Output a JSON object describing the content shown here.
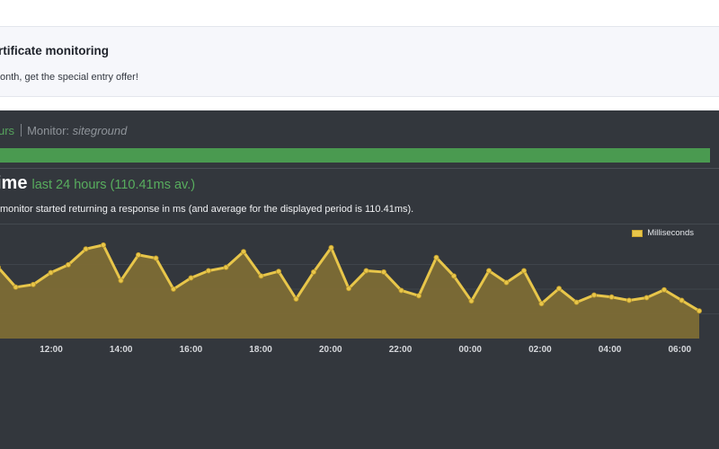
{
  "promo": {
    "title": "rtificate monitoring",
    "text": "onth, get the special entry offer!"
  },
  "monitor": {
    "period_fragment": "urs",
    "label": "Monitor:",
    "name": "siteground"
  },
  "response_time": {
    "title_fragment": "ime",
    "subtitle": "last 24 hours (110.41ms av.)",
    "description": "monitor started returning a response in ms (and average for the displayed period is 110.41ms)."
  },
  "colors": {
    "panel": "#33373d",
    "status_up": "#4a9a50",
    "series_line": "#e8c64a",
    "series_fill": "#7d6c35"
  },
  "chart_data": {
    "type": "area",
    "legend": [
      "Milliseconds"
    ],
    "legend_position": "top-right",
    "x_tick_labels": [
      "12:00",
      "14:00",
      "16:00",
      "18:00",
      "20:00",
      "22:00",
      "00:00",
      "02:00",
      "04:00",
      "06:00"
    ],
    "ylim": [
      0,
      150
    ],
    "grid": true,
    "series": [
      {
        "name": "Milliseconds",
        "values": [
          108,
          78,
          82,
          100,
          112,
          136,
          142,
          88,
          127,
          122,
          75,
          92,
          103,
          108,
          132,
          95,
          102,
          60,
          101,
          138,
          76,
          103,
          101,
          73,
          65,
          123,
          95,
          57,
          103,
          85,
          103,
          53,
          76,
          55,
          66,
          63,
          58,
          62,
          74,
          58,
          42
        ]
      }
    ]
  }
}
